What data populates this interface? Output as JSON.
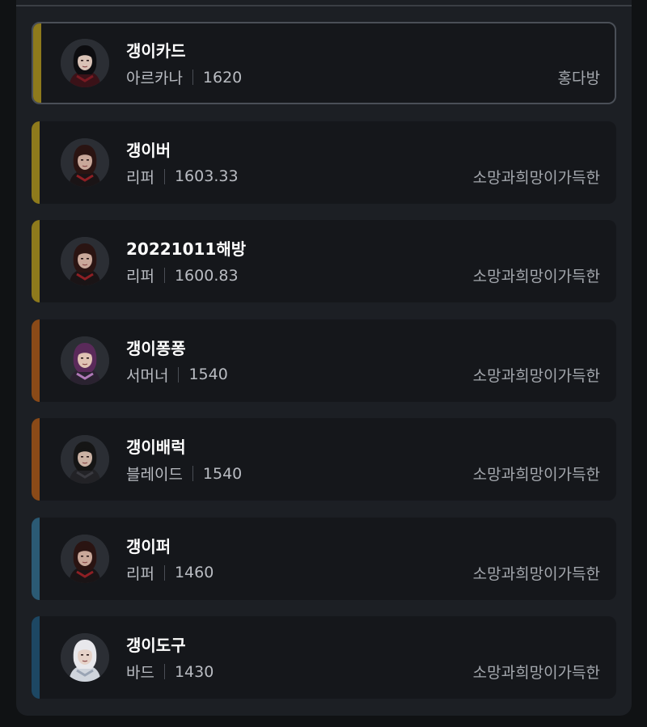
{
  "colors": {
    "tier_gold": "#8e7a1c",
    "tier_orange": "#8a4a18",
    "tier_steel": "#2b5a74",
    "tier_navy": "#1d4763"
  },
  "characters": [
    {
      "name": "갱이카드",
      "class": "아르카나",
      "item_level": "1620",
      "guild": "홍다방",
      "tier_color": "#8e7a1c",
      "avatar_icon": "arcana-portrait-icon",
      "selected": true
    },
    {
      "name": "갱이버",
      "class": "리퍼",
      "item_level": "1603.33",
      "guild": "소망과희망이가득한",
      "tier_color": "#8e7a1c",
      "avatar_icon": "reaper-portrait-icon",
      "selected": false
    },
    {
      "name": "20221011해방",
      "class": "리퍼",
      "item_level": "1600.83",
      "guild": "소망과희망이가득한",
      "tier_color": "#8e7a1c",
      "avatar_icon": "reaper-portrait-icon",
      "selected": false
    },
    {
      "name": "갱이퐁퐁",
      "class": "서머너",
      "item_level": "1540",
      "guild": "소망과희망이가득한",
      "tier_color": "#8a4a18",
      "avatar_icon": "summoner-portrait-icon",
      "selected": false
    },
    {
      "name": "갱이배럭",
      "class": "블레이드",
      "item_level": "1540",
      "guild": "소망과희망이가득한",
      "tier_color": "#8a4a18",
      "avatar_icon": "blade-portrait-icon",
      "selected": false
    },
    {
      "name": "갱이퍼",
      "class": "리퍼",
      "item_level": "1460",
      "guild": "소망과희망이가득한",
      "tier_color": "#2b5a74",
      "avatar_icon": "reaper-portrait-icon",
      "selected": false
    },
    {
      "name": "갱이도구",
      "class": "바드",
      "item_level": "1430",
      "guild": "소망과희망이가득한",
      "tier_color": "#1d4763",
      "avatar_icon": "bard-portrait-icon",
      "selected": false
    }
  ]
}
